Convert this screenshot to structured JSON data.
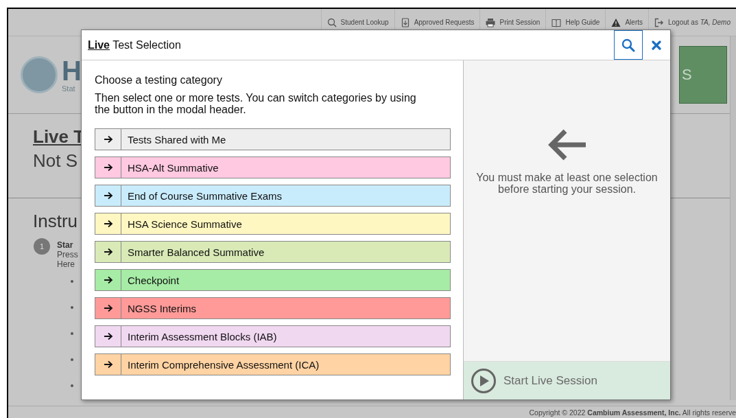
{
  "top_nav": [
    {
      "label": "Student Lookup"
    },
    {
      "label": "Approved Requests"
    },
    {
      "label": "Print Session"
    },
    {
      "label": "Help Guide"
    },
    {
      "label": "Alerts"
    },
    {
      "label": "Logout as *TA, Demo*"
    }
  ],
  "header": {
    "title_partial": "H",
    "subtitle_partial": "Stat",
    "button_partial": "S"
  },
  "session": {
    "title_partial": "Live T",
    "status_partial": "Not S"
  },
  "instructions": {
    "heading_partial": "Instru",
    "step_number": "1",
    "step_title_partial": "Star",
    "lines_partial": [
      "Press",
      "Here"
    ]
  },
  "footer": {
    "copyright": "Copyright © 2022 **Cambium Assessment, Inc.** All rights reserve"
  },
  "modal": {
    "title": "**Live** Test Selection",
    "heading": "Choose a testing category",
    "instructions": "Then select one or more tests. You can switch categories by using the button in the modal header.",
    "categories": [
      {
        "label": "Tests Shared with Me",
        "color": "#eeeeee"
      },
      {
        "label": "HSA-Alt Summative",
        "color": "#ffc9e1"
      },
      {
        "label": "End of Course Summative Exams",
        "color": "#c9ecfc"
      },
      {
        "label": "HSA Science Summative",
        "color": "#fff7c1"
      },
      {
        "label": "Smarter Balanced Summative",
        "color": "#d9eab7"
      },
      {
        "label": "Checkpoint",
        "color": "#a6eba6"
      },
      {
        "label": "NGSS Interims",
        "color": "#ff9a98"
      },
      {
        "label": "Interim Assessment Blocks (IAB)",
        "color": "#f1d8f1"
      },
      {
        "label": "Interim Comprehensive Assessment (ICA)",
        "color": "#ffd3a3"
      }
    ],
    "empty_message": "You must make at least one selection before starting your session.",
    "start_button": {
      "label": "Start Live Session",
      "disabled": true
    }
  }
}
